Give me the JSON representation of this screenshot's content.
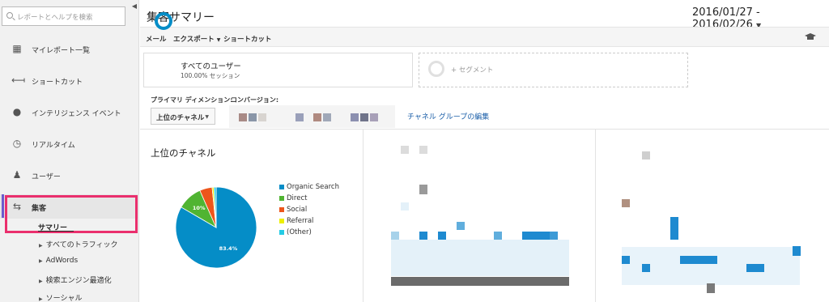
{
  "sidebar": {
    "search_placeholder": "レポートとヘルプを検索",
    "items": [
      {
        "label": "マイレポート一覧",
        "icon": "grid-icon"
      },
      {
        "label": "ショートカット",
        "icon": "shortcut-icon"
      },
      {
        "label": "インテリジェンス イベント",
        "icon": "bulb-icon"
      },
      {
        "label": "リアルタイム",
        "icon": "clock-icon"
      },
      {
        "label": "ユーザー",
        "icon": "users-icon"
      },
      {
        "label": "集客",
        "icon": "acquisition-icon"
      }
    ],
    "active_sub": "サマリー",
    "subitems": [
      "すべてのトラフィック",
      "AdWords",
      "検索エンジン最適化",
      "ソーシャル"
    ]
  },
  "header": {
    "title": "集客サマリー",
    "date_range": "2016/01/27 - 2016/02/26"
  },
  "toolbar": {
    "email": "メール",
    "export": "エクスポート",
    "shortcut": "ショートカット"
  },
  "segments": {
    "all_users": "すべてのユーザー",
    "all_users_pct": "100.00% セッション",
    "add_segment": "+ セグメント"
  },
  "controls": {
    "primary_dim_label": "プライマリ ディメンション:",
    "primary_dim_value": "上位のチャネル",
    "conversion_label": "コンバージョン:",
    "edit_link": "チャネル グループの編集"
  },
  "chart_data": {
    "type": "pie",
    "title": "上位のチャネル",
    "series": [
      {
        "name": "Organic Search",
        "value": 83.4,
        "color": "#058dc7"
      },
      {
        "name": "Direct",
        "value": 10.0,
        "color": "#50b432"
      },
      {
        "name": "Social",
        "value": 5.0,
        "color": "#ed561b"
      },
      {
        "name": "Referral",
        "value": 0.7,
        "color": "#edef00"
      },
      {
        "name": "(Other)",
        "value": 0.9,
        "color": "#24cbe5"
      }
    ],
    "data_labels": [
      "83.4%",
      "10%"
    ]
  },
  "colors": {
    "accent": "#058dc7",
    "highlight": "#ea2f6d"
  }
}
